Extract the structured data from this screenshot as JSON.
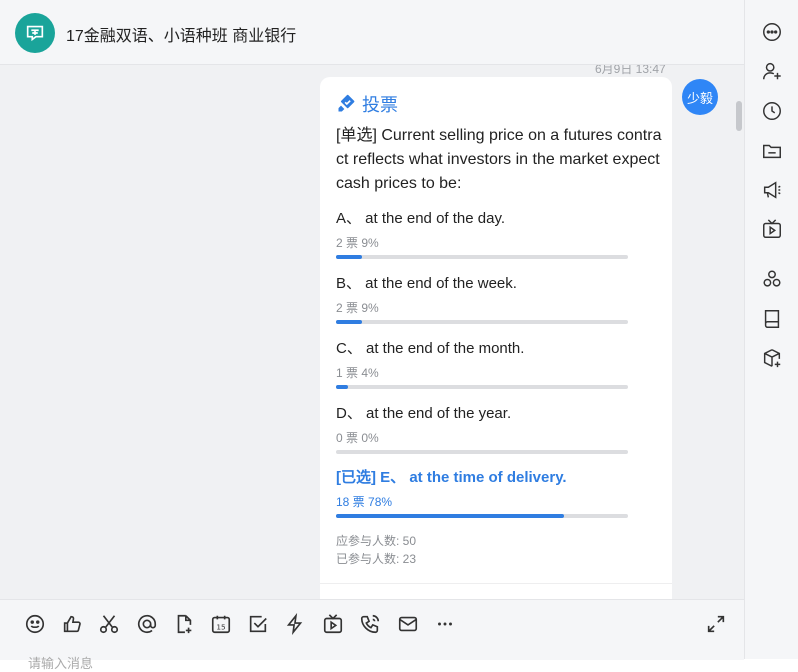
{
  "header": {
    "title": "17金融双语、小语种班 商业银行"
  },
  "message": {
    "timestamp": "6月9日 13:47",
    "sender_name": "少毅"
  },
  "poll": {
    "label": "投票",
    "question": "[单选] Current selling price on a futures contract reflects what investors in the market expect cash prices to be:",
    "options": [
      {
        "text": "A、 at the end of the day.",
        "meta": "2 票  9%",
        "percent": 9,
        "selected": false
      },
      {
        "text": "B、 at the end of the week.",
        "meta": "2 票  9%",
        "percent": 9,
        "selected": false
      },
      {
        "text": "C、 at the end of the month.",
        "meta": "1 票  4%",
        "percent": 4,
        "selected": false
      },
      {
        "text": "D、 at the end of the year.",
        "meta": "0 票  0%",
        "percent": 0,
        "selected": false
      },
      {
        "text": "[已选] E、 at the time of delivery.",
        "meta": "18 票  78%",
        "percent": 78,
        "selected": true
      }
    ],
    "expected": "应参与人数: 50",
    "participated": "已参与人数: 23"
  },
  "toolbar": {
    "icons": [
      "emoji-icon",
      "thumbs-up-icon",
      "scissors-icon",
      "at-icon",
      "new-doc-icon",
      "calendar-icon",
      "task-check-icon",
      "lightning-icon",
      "live-tv-icon",
      "phone-call-icon",
      "mail-icon",
      "more-icon"
    ],
    "calendar_day": "15",
    "expand_icon": "expand-icon"
  },
  "input": {
    "placeholder": "请输入消息"
  },
  "rightbar": {
    "icons": [
      "more-options-icon",
      "add-member-icon",
      "history-clock-icon",
      "folder-icon",
      "announcement-icon",
      "tv-icon",
      "apps-icon",
      "book-icon",
      "cube-add-icon"
    ]
  },
  "colors": {
    "accent": "#2f7de1",
    "avatar_group": "#1aa49a",
    "avatar_user": "#2f86f6"
  }
}
